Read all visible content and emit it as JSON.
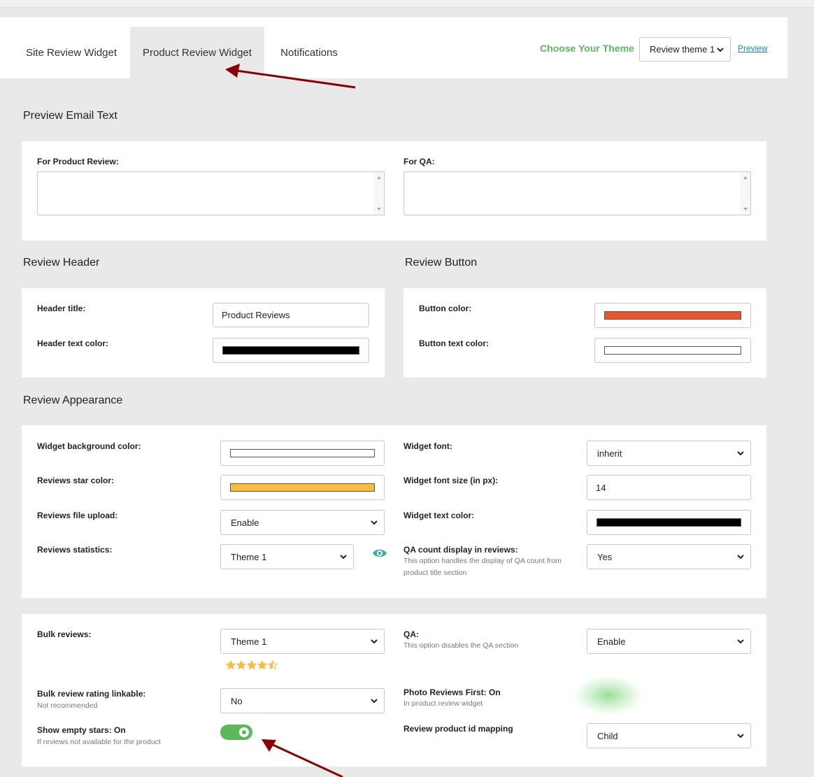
{
  "tabs": [
    "Site Review Widget",
    "Product Review Widget",
    "Notifications"
  ],
  "theme_chooser": {
    "label": "Choose Your Theme",
    "selected": "Review theme 1",
    "preview_link": "Preview"
  },
  "preview_email": {
    "title": "Preview Email Text",
    "product_review_label": "For Product Review:",
    "product_review_value": "",
    "qa_label": "For QA:",
    "qa_value": ""
  },
  "review_header": {
    "title": "Review Header",
    "header_title_label": "Header title:",
    "header_title_value": "Product Reviews",
    "header_text_color_label": "Header text color:",
    "header_text_color": "#000000"
  },
  "review_button": {
    "title": "Review Button",
    "button_color_label": "Button color:",
    "button_color": "#e5562a",
    "button_text_color_label": "Button text color:",
    "button_text_color": "#ffffff"
  },
  "review_appearance": {
    "title": "Review Appearance",
    "widget_bg_color_label": "Widget background color:",
    "widget_bg_color": "#ffffff",
    "star_color_label": "Reviews star color:",
    "star_color": "#fbbc3d",
    "file_upload_label": "Reviews file upload:",
    "file_upload_value": "Enable",
    "statistics_label": "Reviews statistics:",
    "statistics_value": "Theme 1",
    "widget_font_label": "Widget font:",
    "widget_font_value": "inherit",
    "font_size_label": "Widget font size (in px):",
    "font_size_value": "14",
    "widget_text_color_label": "Widget text color:",
    "widget_text_color": "#000000",
    "qa_count_label": "QA count display in reviews:",
    "qa_count_sub": "This option handles the display of QA count from product title section",
    "qa_count_value": "Yes"
  },
  "bulk": {
    "bulk_reviews_label": "Bulk reviews:",
    "bulk_reviews_value": "Theme 1",
    "stars_rating": 4.5,
    "linkable_label": "Bulk review rating linkable:",
    "linkable_sub": "Not recommended",
    "linkable_value": "No",
    "empty_stars_label": "Show empty stars: On",
    "empty_stars_sub": "If reviews not available for the product",
    "empty_stars_on": true,
    "qa_label": "QA:",
    "qa_sub": "This option disables the QA section",
    "qa_value": "Enable",
    "photo_first_label": "Photo Reviews First: On",
    "photo_first_sub": "In product review widget",
    "id_mapping_label": "Review product id mapping",
    "id_mapping_value": "Child"
  },
  "colors": {
    "accent_green": "#5cb85c",
    "annotation_arrow": "#8b0000",
    "link": "#1a7ed1",
    "eye_icon": "#3bb0a6"
  }
}
